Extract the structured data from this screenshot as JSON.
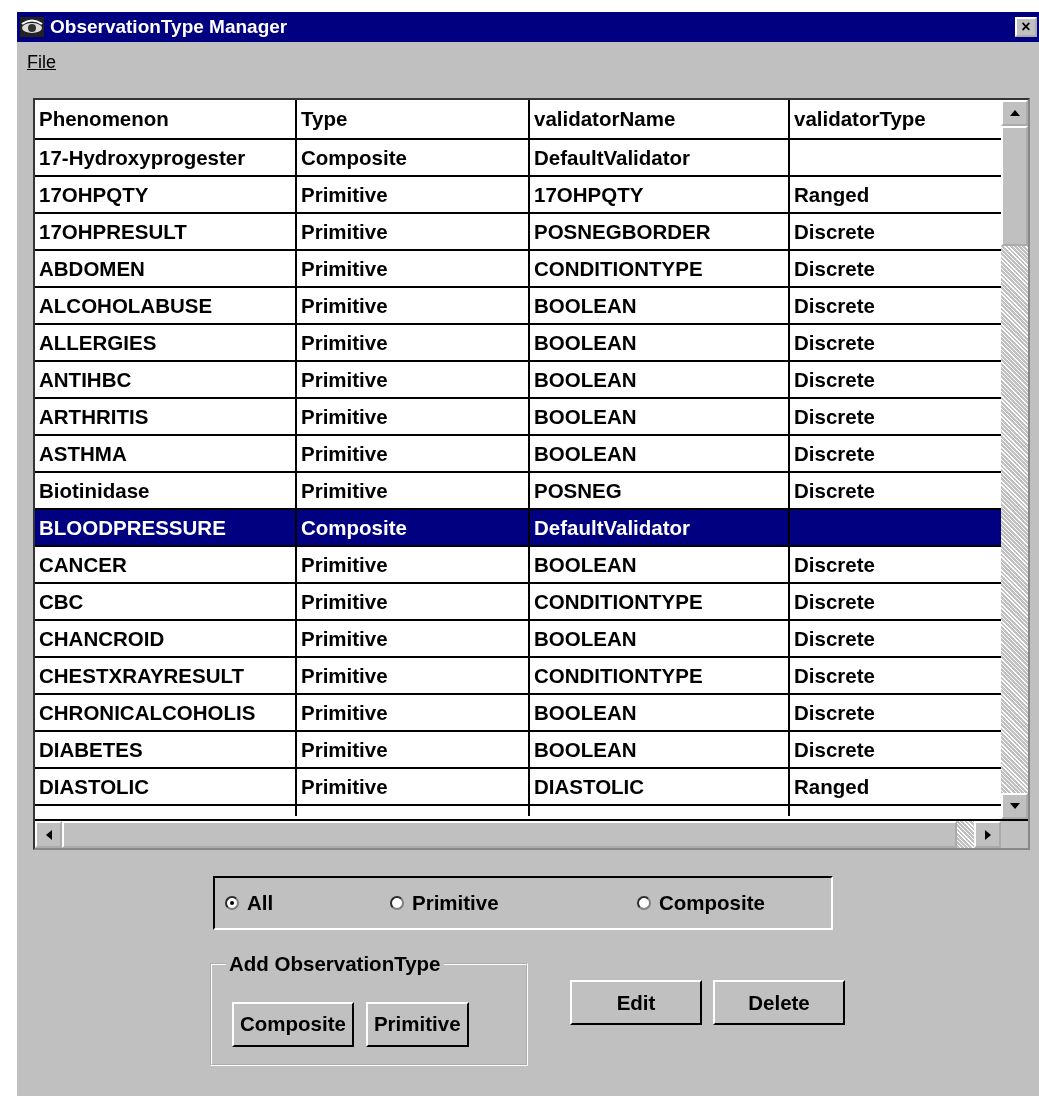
{
  "window": {
    "title": "ObservationType Manager",
    "close": "×"
  },
  "menu": [
    {
      "label": "File"
    }
  ],
  "table": {
    "columns": [
      "Phenomenon",
      "Type",
      "validatorName",
      "validatorType"
    ],
    "rows": [
      {
        "cells": [
          "17-Hydroxyprogester",
          "Composite",
          "DefaultValidator"
        ],
        "selected": false
      },
      {
        "cells": [
          "17OHPQTY",
          "Primitive",
          "17OHPQTY",
          "Ranged"
        ],
        "selected": false
      },
      {
        "cells": [
          "17OHPRESULT",
          "Primitive",
          "POSNEGBORDER",
          "Discrete"
        ],
        "selected": false
      },
      {
        "cells": [
          "ABDOMEN",
          "Primitive",
          "CONDITIONTYPE",
          "Discrete"
        ],
        "selected": false
      },
      {
        "cells": [
          "ALCOHOLABUSE",
          "Primitive",
          "BOOLEAN",
          "Discrete"
        ],
        "selected": false
      },
      {
        "cells": [
          "ALLERGIES",
          "Primitive",
          "BOOLEAN",
          "Discrete"
        ],
        "selected": false
      },
      {
        "cells": [
          "ANTIHBC",
          "Primitive",
          "BOOLEAN",
          "Discrete"
        ],
        "selected": false
      },
      {
        "cells": [
          "ARTHRITIS",
          "Primitive",
          "BOOLEAN",
          "Discrete"
        ],
        "selected": false
      },
      {
        "cells": [
          "ASTHMA",
          "Primitive",
          "BOOLEAN",
          "Discrete"
        ],
        "selected": false
      },
      {
        "cells": [
          "Biotinidase",
          "Primitive",
          "POSNEG",
          "Discrete"
        ],
        "selected": false
      },
      {
        "cells": [
          "BLOODPRESSURE",
          "Composite",
          "DefaultValidator"
        ],
        "selected": true
      },
      {
        "cells": [
          "CANCER",
          "Primitive",
          "BOOLEAN",
          "Discrete"
        ],
        "selected": false
      },
      {
        "cells": [
          "CBC",
          "Primitive",
          "CONDITIONTYPE",
          "Discrete"
        ],
        "selected": false
      },
      {
        "cells": [
          "CHANCROID",
          "Primitive",
          "BOOLEAN",
          "Discrete"
        ],
        "selected": false
      },
      {
        "cells": [
          "CHESTXRAYRESULT",
          "Primitive",
          "CONDITIONTYPE",
          "Discrete"
        ],
        "selected": false
      },
      {
        "cells": [
          "CHRONICALCOHOLIS",
          "Primitive",
          "BOOLEAN",
          "Discrete"
        ],
        "selected": false
      },
      {
        "cells": [
          "DIABETES",
          "Primitive",
          "BOOLEAN",
          "Discrete"
        ],
        "selected": false
      },
      {
        "cells": [
          "DIASTOLIC",
          "Primitive",
          "DIASTOLIC",
          "Ranged"
        ],
        "selected": false
      }
    ]
  },
  "filter": [
    {
      "label": "All",
      "selected": true
    },
    {
      "label": "Primitive",
      "selected": false
    },
    {
      "label": "Composite",
      "selected": false
    }
  ],
  "add_group": {
    "title": "Add ObservationType",
    "buttons": [
      "Composite",
      "Primitive"
    ]
  },
  "buttons": [
    "Edit",
    "Delete"
  ]
}
